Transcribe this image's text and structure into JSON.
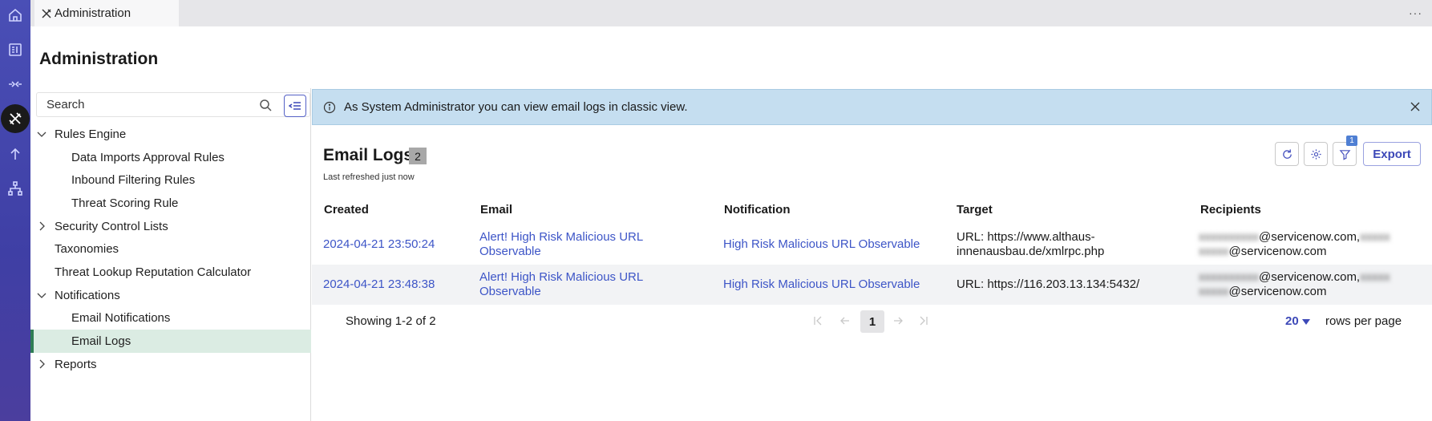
{
  "tab": {
    "label": "Administration"
  },
  "page": {
    "title": "Administration"
  },
  "sidebar": {
    "search_placeholder": "Search",
    "items": [
      {
        "label": "Rules Engine",
        "level": 0,
        "expander": "expanded"
      },
      {
        "label": "Data Imports Approval Rules",
        "level": 1
      },
      {
        "label": "Inbound Filtering Rules",
        "level": 1
      },
      {
        "label": "Threat Scoring Rule",
        "level": 1
      },
      {
        "label": "Security Control Lists",
        "level": 0,
        "expander": "collapsed"
      },
      {
        "label": "Taxonomies",
        "level": 0
      },
      {
        "label": "Threat Lookup Reputation Calculator",
        "level": 0
      },
      {
        "label": "Notifications",
        "level": 0,
        "expander": "expanded"
      },
      {
        "label": "Email Notifications",
        "level": 1
      },
      {
        "label": "Email Logs",
        "level": 1,
        "selected": true
      },
      {
        "label": "Reports",
        "level": 0,
        "expander": "collapsed"
      }
    ]
  },
  "banner": {
    "text": "As System Administrator you can view email logs in classic view."
  },
  "logs": {
    "title": "Email Logs",
    "count": "2",
    "refreshed": "Last refreshed just now",
    "filter_count": "1",
    "export_label": "Export",
    "columns": [
      "Created",
      "Email",
      "Notification",
      "Target",
      "Recipients"
    ],
    "rows": [
      {
        "created": "2024-04-21 23:50:24",
        "email": "Alert! High Risk Malicious URL Observable",
        "notification": "High Risk Malicious URL Observable",
        "target": "URL: https://www.althaus-innenausbau.de/xmlrpc.php",
        "recipients_line1": "@servicenow.com,",
        "recipients_line2": "@servicenow.com"
      },
      {
        "created": "2024-04-21 23:48:38",
        "email": "Alert! High Risk Malicious URL Observable",
        "notification": "High Risk Malicious URL Observable",
        "target": "URL: https://116.203.13.134:5432/",
        "recipients_line1": "@servicenow.com,",
        "recipients_line2": "@servicenow.com"
      }
    ]
  },
  "pager": {
    "showing": "Showing 1-2 of 2",
    "current_page": "1",
    "rows_per_page": "20",
    "rows_label": "rows per page"
  },
  "colors": {
    "rail": "#4a4fb6",
    "accent": "#3d49b8",
    "link": "#3d55c7",
    "banner": "#c5def0",
    "selected": "#dbece3"
  }
}
